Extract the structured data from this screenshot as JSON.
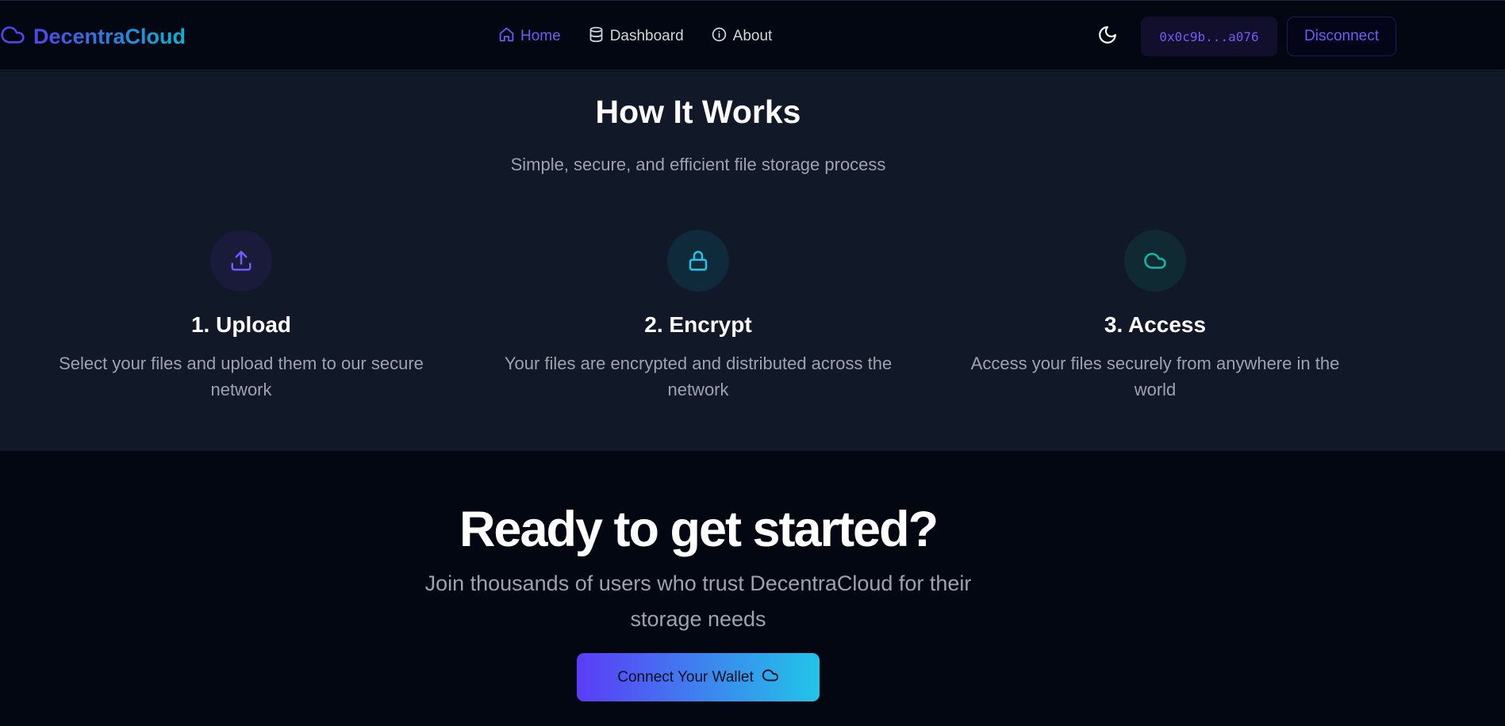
{
  "colors": {
    "accent": "#6d5cf6",
    "cyan": "#06b6d4",
    "teal": "#14b8a6",
    "background": "#030712",
    "section_bg": "#111827"
  },
  "navbar": {
    "brand": {
      "name": "DecentraCloud",
      "icon": "cloud-icon"
    },
    "links": [
      {
        "label": "Home",
        "icon": "home-icon",
        "active": true
      },
      {
        "label": "Dashboard",
        "icon": "database-icon",
        "active": false
      },
      {
        "label": "About",
        "icon": "info-icon",
        "active": false
      }
    ],
    "theme_toggle_icon": "moon-icon",
    "wallet_address": "0x0c9b...a076",
    "disconnect_label": "Disconnect"
  },
  "how_it_works": {
    "title": "How It Works",
    "subtitle": "Simple, secure, and efficient file storage process",
    "steps": [
      {
        "title": "1. Upload",
        "description": "Select your files and upload them to our secure network",
        "icon": "upload-icon"
      },
      {
        "title": "2. Encrypt",
        "description": "Your files are encrypted and distributed across the network",
        "icon": "lock-icon"
      },
      {
        "title": "3. Access",
        "description": "Access your files securely from anywhere in the world",
        "icon": "cloud-icon"
      }
    ]
  },
  "cta": {
    "title": "Ready to get started?",
    "description": "Join thousands of users who trust DecentraCloud for their storage needs",
    "button_label": "Connect Your Wallet",
    "button_icon": "cloud-icon"
  }
}
